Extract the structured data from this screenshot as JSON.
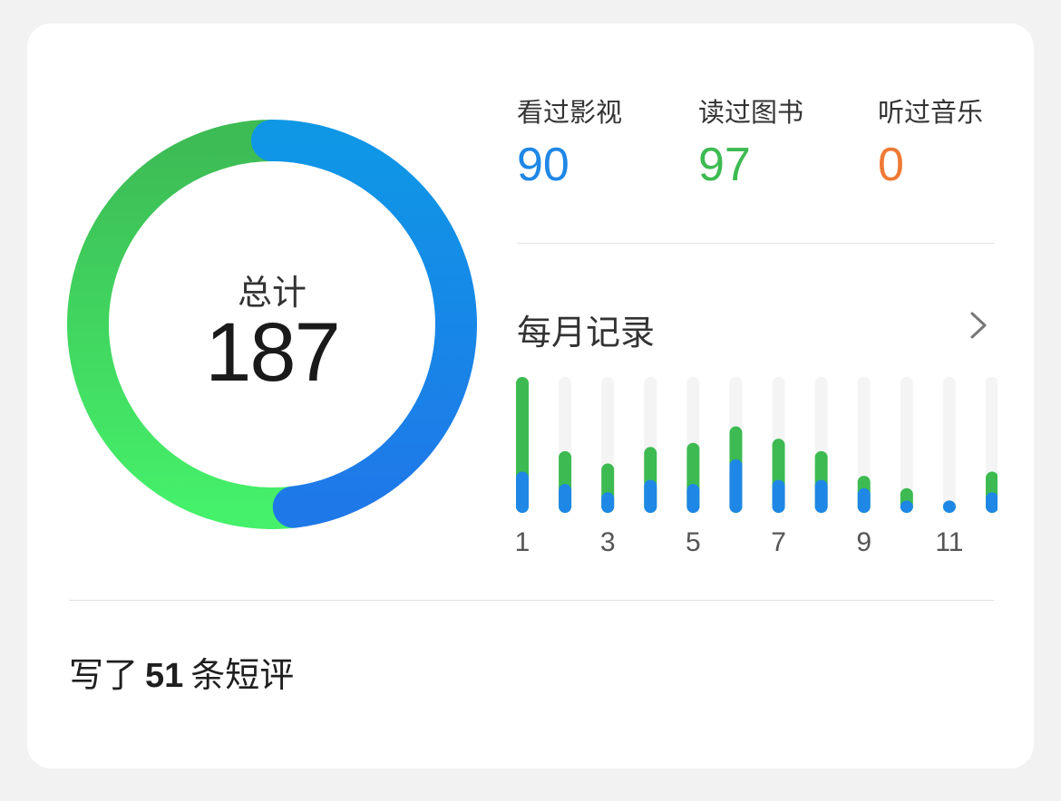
{
  "summary": {
    "total_label": "总计",
    "total_value": "187"
  },
  "stats": [
    {
      "label": "看过影视",
      "value": "90",
      "color": "#1f87e5"
    },
    {
      "label": "读过图书",
      "value": "97",
      "color": "#3dbb52"
    },
    {
      "label": "听过音乐",
      "value": "0",
      "color": "#ee7a35"
    }
  ],
  "donut": {
    "segments": [
      {
        "name": "看过影视",
        "value": 90,
        "color_start": "#0f97e6",
        "color_end": "#1f78e8"
      },
      {
        "name": "读过图书",
        "value": 97,
        "color_start": "#45f06a",
        "color_end": "#3dbb55"
      }
    ]
  },
  "monthly": {
    "title": "每月记录",
    "chevron_icon": "chevron-right-icon"
  },
  "chart_data": {
    "type": "bar",
    "stacked": true,
    "categories": [
      "1",
      "2",
      "3",
      "4",
      "5",
      "6",
      "7",
      "8",
      "9",
      "10",
      "11",
      "12"
    ],
    "tick_labels": [
      "1",
      "3",
      "5",
      "7",
      "9",
      "11"
    ],
    "series": [
      {
        "name": "看过影视",
        "color": "#1f87e5",
        "values": [
          10,
          7,
          5,
          8,
          7,
          13,
          8,
          8,
          6,
          3,
          3,
          5
        ]
      },
      {
        "name": "读过图书",
        "color": "#3dbb52",
        "values": [
          23,
          8,
          7,
          8,
          10,
          8,
          10,
          7,
          3,
          3,
          0,
          5
        ]
      }
    ],
    "ylim": [
      0,
      33
    ],
    "grid": false
  },
  "reviews": {
    "prefix": "写了",
    "count": "51",
    "suffix": "条短评"
  }
}
